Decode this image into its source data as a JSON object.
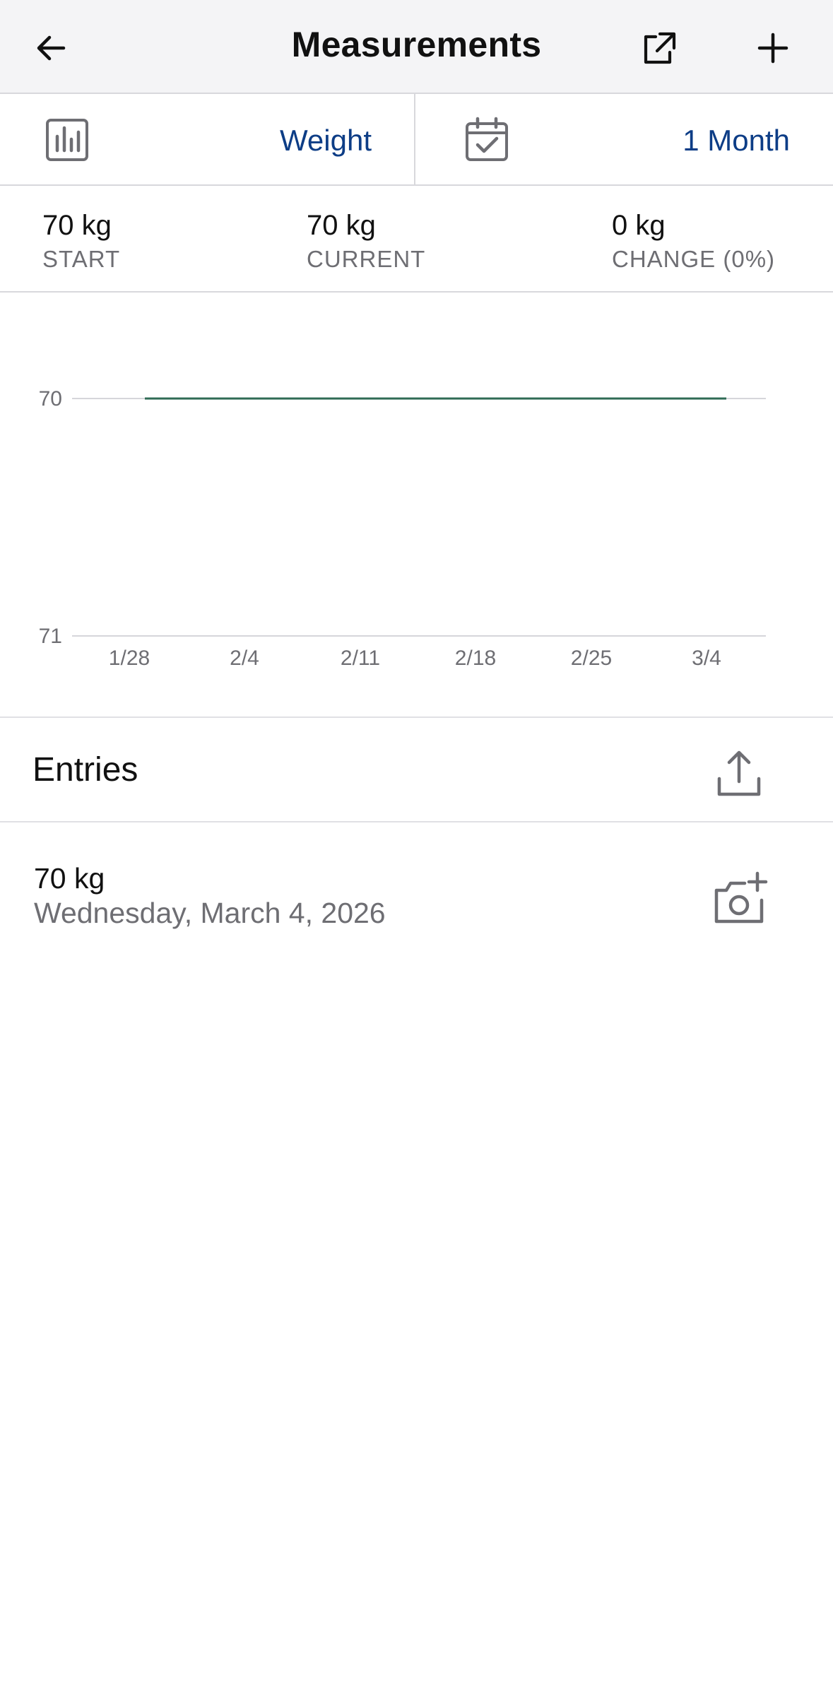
{
  "header": {
    "title": "Measurements",
    "back_icon": "arrow-left-icon",
    "external_icon": "external-link-icon",
    "add_icon": "plus-icon"
  },
  "selector": {
    "metric_label": "Weight",
    "metric_icon": "bar-chart-icon",
    "range_label": "1 Month",
    "range_icon": "calendar-check-icon"
  },
  "stats": {
    "start": {
      "value": "70 kg",
      "label": "START"
    },
    "current": {
      "value": "70 kg",
      "label": "CURRENT"
    },
    "change": {
      "value": "0 kg",
      "label": "CHANGE (0%)"
    }
  },
  "colors": {
    "accent": "#0d3d86",
    "line": "#2f6b55",
    "muted": "#6e6e73"
  },
  "chart_data": {
    "type": "line",
    "x": [
      "1/28",
      "2/4",
      "2/11",
      "2/18",
      "2/25",
      "3/4"
    ],
    "series": [
      {
        "values": [
          70,
          70,
          70,
          70,
          70,
          70
        ],
        "start": "1/28",
        "end": "3/4"
      }
    ],
    "yticks": [
      "70",
      "71"
    ],
    "grid": true
  },
  "entries": {
    "title": "Entries",
    "share_icon": "share-icon",
    "items": [
      {
        "value": "70 kg",
        "date": "Wednesday, March 4, 2026",
        "photo_icon": "camera-add-icon"
      }
    ]
  }
}
